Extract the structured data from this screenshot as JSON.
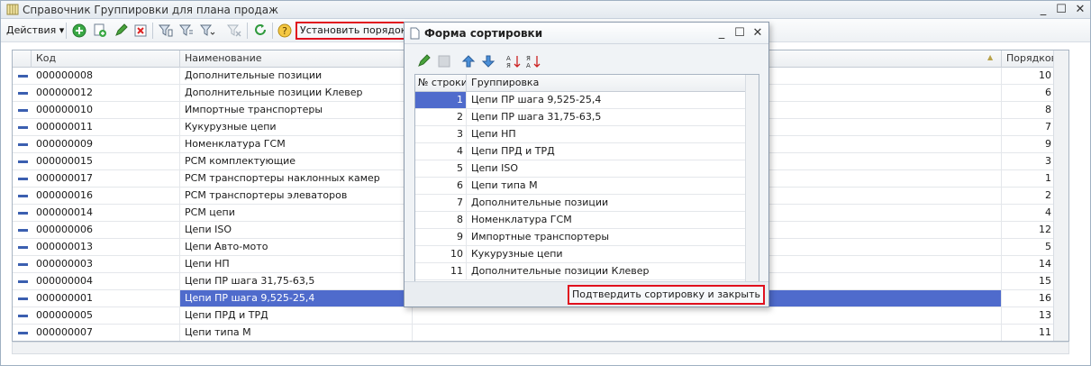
{
  "window": {
    "title": "Справочник Группировки для плана продаж",
    "minimize": "_",
    "maximize": "☐",
    "close": "✕"
  },
  "toolbar": {
    "actions_label": "Действия",
    "set_order_label": "Установить порядок"
  },
  "grid": {
    "columns": [
      "Код",
      "Наименование",
      "Порядковы..."
    ],
    "rows": [
      {
        "code": "000000008",
        "name": "Дополнительные позиции",
        "order": "10"
      },
      {
        "code": "000000012",
        "name": "Дополнительные позиции Клевер",
        "order": "6"
      },
      {
        "code": "000000010",
        "name": "Импортные транспортеры",
        "order": "8"
      },
      {
        "code": "000000011",
        "name": "Кукурузные цепи",
        "order": "7"
      },
      {
        "code": "000000009",
        "name": "Номенклатура ГСМ",
        "order": "9"
      },
      {
        "code": "000000015",
        "name": "РСМ комплектующие",
        "order": "3"
      },
      {
        "code": "000000017",
        "name": "РСМ транспортеры наклонных камер",
        "order": "1"
      },
      {
        "code": "000000016",
        "name": "РСМ транспортеры элеваторов",
        "order": "2"
      },
      {
        "code": "000000014",
        "name": "РСМ цепи",
        "order": "4"
      },
      {
        "code": "000000006",
        "name": "Цепи ISO",
        "order": "12"
      },
      {
        "code": "000000013",
        "name": "Цепи Авто-мото",
        "order": "5"
      },
      {
        "code": "000000003",
        "name": "Цепи НП",
        "order": "14"
      },
      {
        "code": "000000004",
        "name": "Цепи ПР шага 31,75-63,5",
        "order": "15"
      },
      {
        "code": "000000001",
        "name": "Цепи ПР шага 9,525-25,4",
        "order": "16"
      },
      {
        "code": "000000005",
        "name": "Цепи ПРД и ТРД",
        "order": "13"
      },
      {
        "code": "000000007",
        "name": "Цепи типа М",
        "order": "11"
      }
    ],
    "selected_row_index": 13
  },
  "dialog": {
    "title": "Форма сортировки",
    "minimize": "_",
    "maximize": "☐",
    "close": "✕",
    "columns": [
      "№ строки",
      "Группировка"
    ],
    "rows": [
      {
        "n": "1",
        "name": "Цепи ПР шага 9,525-25,4"
      },
      {
        "n": "2",
        "name": "Цепи ПР шага 31,75-63,5"
      },
      {
        "n": "3",
        "name": "Цепи НП"
      },
      {
        "n": "4",
        "name": "Цепи ПРД и ТРД"
      },
      {
        "n": "5",
        "name": "Цепи ISO"
      },
      {
        "n": "6",
        "name": "Цепи типа М"
      },
      {
        "n": "7",
        "name": "Дополнительные позиции"
      },
      {
        "n": "8",
        "name": "Номенклатура ГСМ"
      },
      {
        "n": "9",
        "name": "Импортные транспортеры"
      },
      {
        "n": "10",
        "name": "Кукурузные цепи"
      },
      {
        "n": "11",
        "name": "Дополнительные позиции Клевер"
      }
    ],
    "selected_row_index": 0,
    "confirm_label": "Подтвердить сортировку и закрыть"
  },
  "colors": {
    "selection": "#4f6bcc",
    "highlight_border": "#e0101e"
  }
}
